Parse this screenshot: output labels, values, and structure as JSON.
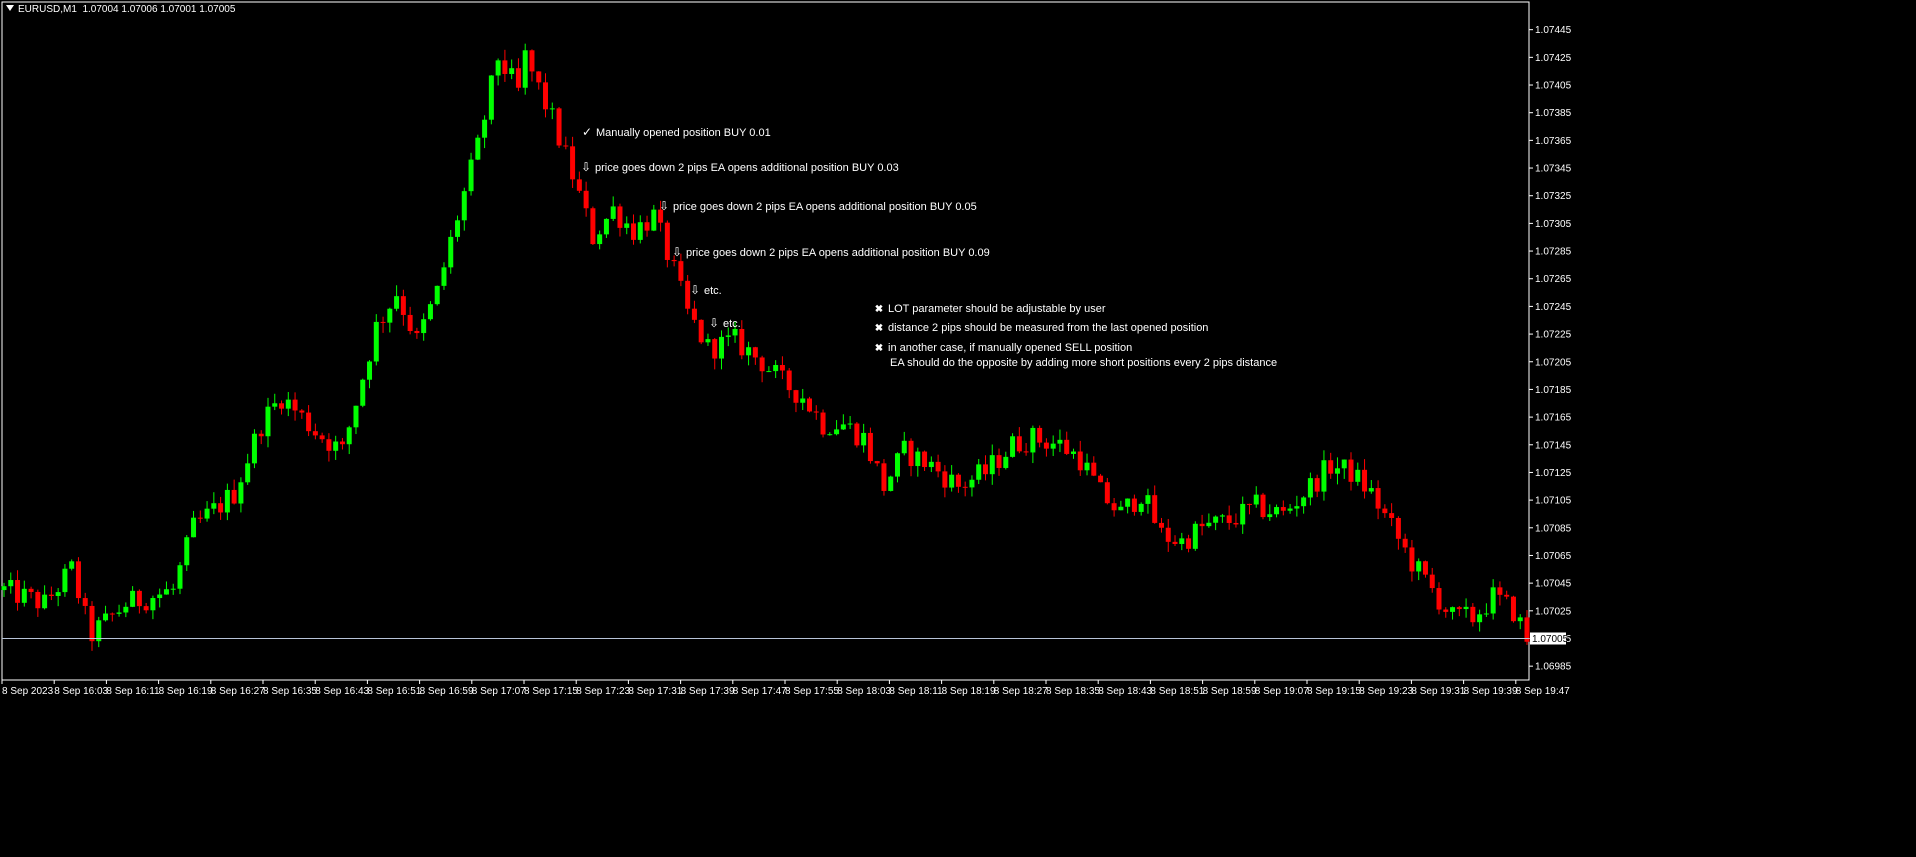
{
  "header": {
    "symbol": "EURUSD,M1",
    "ohlc": "1.07004 1.07006 1.07001 1.07005"
  },
  "colors": {
    "background": "#000000",
    "bull": "#00ff00",
    "bear": "#ff0000",
    "axis": "#ffffff",
    "text": "#ffffff"
  },
  "annotations": [
    {
      "icon": "check-icon",
      "glyph": "✓",
      "text": "Manually opened position BUY 0.01"
    },
    {
      "icon": "down-arrow-icon",
      "glyph": "⇩",
      "text": "price goes down 2 pips EA opens additional position BUY 0.03"
    },
    {
      "icon": "down-arrow-icon",
      "glyph": "⇩",
      "text": "price goes down 2 pips EA opens additional position BUY 0.05"
    },
    {
      "icon": "down-arrow-icon",
      "glyph": "⇩",
      "text": "price goes down 2 pips EA opens additional position BUY 0.09"
    },
    {
      "icon": "down-arrow-icon",
      "glyph": "⇩",
      "text": "etc."
    },
    {
      "icon": "down-arrow-icon",
      "glyph": "⇩",
      "text": "etc."
    }
  ],
  "notes": [
    {
      "icon": "cross-icon",
      "glyph": "✖",
      "text": "LOT parameter should be adjustable by user"
    },
    {
      "icon": "cross-icon",
      "glyph": "✖",
      "text": "distance 2 pips should be measured from the last opened position"
    },
    {
      "icon": "cross-icon",
      "glyph": "✖",
      "text": "in another case, if manually opened SELL position"
    },
    {
      "icon": "",
      "glyph": "",
      "text": "EA should do the opposite by adding more short positions every 2 pips distance"
    }
  ],
  "chart_data": {
    "type": "candlestick",
    "ylim": [
      1.06975,
      1.07465
    ],
    "y_ticks": [
      "1.07445",
      "1.07425",
      "1.07405",
      "1.07385",
      "1.07365",
      "1.07345",
      "1.07325",
      "1.07305",
      "1.07285",
      "1.07265",
      "1.07245",
      "1.07225",
      "1.07205",
      "1.07185",
      "1.07165",
      "1.07145",
      "1.07125",
      "1.07105",
      "1.07085",
      "1.07065",
      "1.07045",
      "1.07025",
      "1.07005",
      "1.06985"
    ],
    "x_ticks": [
      "8 Sep 2023",
      "8 Sep 16:03",
      "8 Sep 16:11",
      "8 Sep 16:19",
      "8 Sep 16:27",
      "8 Sep 16:35",
      "8 Sep 16:43",
      "8 Sep 16:51",
      "8 Sep 16:59",
      "8 Sep 17:07",
      "8 Sep 17:15",
      "8 Sep 17:23",
      "8 Sep 17:31",
      "8 Sep 17:39",
      "8 Sep 17:47",
      "8 Sep 17:55",
      "8 Sep 18:03",
      "8 Sep 18:11",
      "8 Sep 18:19",
      "8 Sep 18:27",
      "8 Sep 18:35",
      "8 Sep 18:43",
      "8 Sep 18:51",
      "8 Sep 18:59",
      "8 Sep 19:07",
      "8 Sep 19:15",
      "8 Sep 19:23",
      "8 Sep 19:31",
      "8 Sep 19:39",
      "8 Sep 19:47"
    ],
    "current_price": "1.07005",
    "anchors": [
      [
        0,
        1.0704
      ],
      [
        6,
        1.0703
      ],
      [
        10,
        1.07055
      ],
      [
        12,
        1.0702
      ],
      [
        13,
        1.07008
      ],
      [
        18,
        1.0703
      ],
      [
        25,
        1.0704
      ],
      [
        28,
        1.07085
      ],
      [
        34,
        1.0711
      ],
      [
        38,
        1.0716
      ],
      [
        41,
        1.0718
      ],
      [
        46,
        1.07155
      ],
      [
        50,
        1.0714
      ],
      [
        55,
        1.0723
      ],
      [
        58,
        1.07255
      ],
      [
        61,
        1.0722
      ],
      [
        64,
        1.07255
      ],
      [
        67,
        1.0731
      ],
      [
        70,
        1.0736
      ],
      [
        73,
        1.07425
      ],
      [
        76,
        1.074
      ],
      [
        77,
        1.07425
      ],
      [
        81,
        1.0738
      ],
      [
        84,
        1.0734
      ],
      [
        87,
        1.07295
      ],
      [
        90,
        1.07315
      ],
      [
        93,
        1.073
      ],
      [
        96,
        1.0731
      ],
      [
        99,
        1.0727
      ],
      [
        101,
        1.0724
      ],
      [
        104,
        1.07215
      ],
      [
        108,
        1.0722
      ],
      [
        112,
        1.07205
      ],
      [
        115,
        1.0719
      ],
      [
        118,
        1.0718
      ],
      [
        121,
        1.0716
      ],
      [
        124,
        1.0716
      ],
      [
        127,
        1.0715
      ],
      [
        130,
        1.07115
      ],
      [
        133,
        1.0714
      ],
      [
        137,
        1.0713
      ],
      [
        141,
        1.07115
      ],
      [
        145,
        1.07125
      ],
      [
        149,
        1.07145
      ],
      [
        152,
        1.0715
      ],
      [
        156,
        1.07145
      ],
      [
        159,
        1.07135
      ],
      [
        162,
        1.0711
      ],
      [
        165,
        1.07095
      ],
      [
        168,
        1.0711
      ],
      [
        171,
        1.0708
      ],
      [
        174,
        1.07075
      ],
      [
        177,
        1.07085
      ],
      [
        181,
        1.0709
      ],
      [
        185,
        1.071
      ],
      [
        189,
        1.07095
      ],
      [
        193,
        1.07115
      ],
      [
        196,
        1.0713
      ],
      [
        199,
        1.07125
      ],
      [
        202,
        1.0711
      ],
      [
        205,
        1.07085
      ],
      [
        208,
        1.0706
      ],
      [
        211,
        1.0704
      ],
      [
        214,
        1.0702
      ],
      [
        217,
        1.0702
      ],
      [
        220,
        1.07035
      ],
      [
        223,
        1.07025
      ],
      [
        225,
        1.07005
      ]
    ]
  }
}
